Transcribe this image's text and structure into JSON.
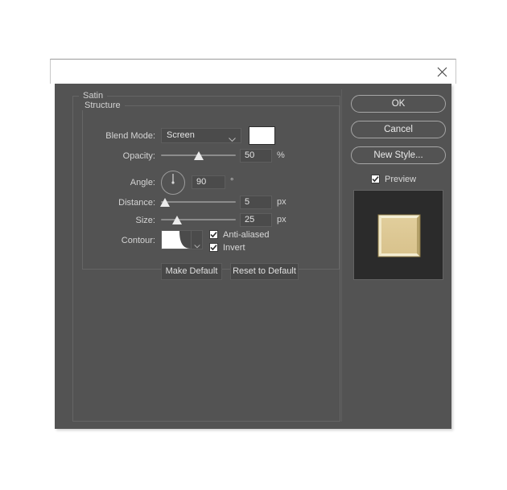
{
  "window": {
    "close_icon": "close-icon"
  },
  "dialog": {
    "groups": {
      "satin_label": "Satin",
      "structure_label": "Structure"
    },
    "fields": {
      "blend_mode": {
        "label": "Blend Mode:",
        "value": "Screen",
        "chevron_icon": "chevron-down-icon",
        "color": "#ffffff"
      },
      "opacity": {
        "label": "Opacity:",
        "value": "50",
        "unit": "%",
        "slider_percent": 50,
        "min": 0,
        "max": 100
      },
      "angle": {
        "label": "Angle:",
        "value": "90",
        "unit": "°",
        "dial_degrees": 90
      },
      "distance": {
        "label": "Distance:",
        "value": "5",
        "unit": "px",
        "slider_percent": 5,
        "min": 1,
        "max": 250
      },
      "size": {
        "label": "Size:",
        "value": "25",
        "unit": "px",
        "slider_percent": 22,
        "min": 0,
        "max": 250
      },
      "contour": {
        "label": "Contour:",
        "chevron_icon": "chevron-down-icon",
        "preset": "Ring"
      }
    },
    "checkboxes": {
      "anti_aliased": {
        "label": "Anti-aliased",
        "checked": true
      },
      "invert": {
        "label": "Invert",
        "checked": true
      }
    },
    "buttons": {
      "make_default": "Make Default",
      "reset_to_default": "Reset to Default"
    }
  },
  "side_panel": {
    "ok": "OK",
    "cancel": "Cancel",
    "new_style": "New Style...",
    "preview": {
      "label": "Preview",
      "checked": true
    },
    "thumbnail": {
      "background": "#2b2b2b",
      "fill": "#ddc894",
      "highlight": "#f3ecd0",
      "shadow": "#8c7a45"
    }
  }
}
